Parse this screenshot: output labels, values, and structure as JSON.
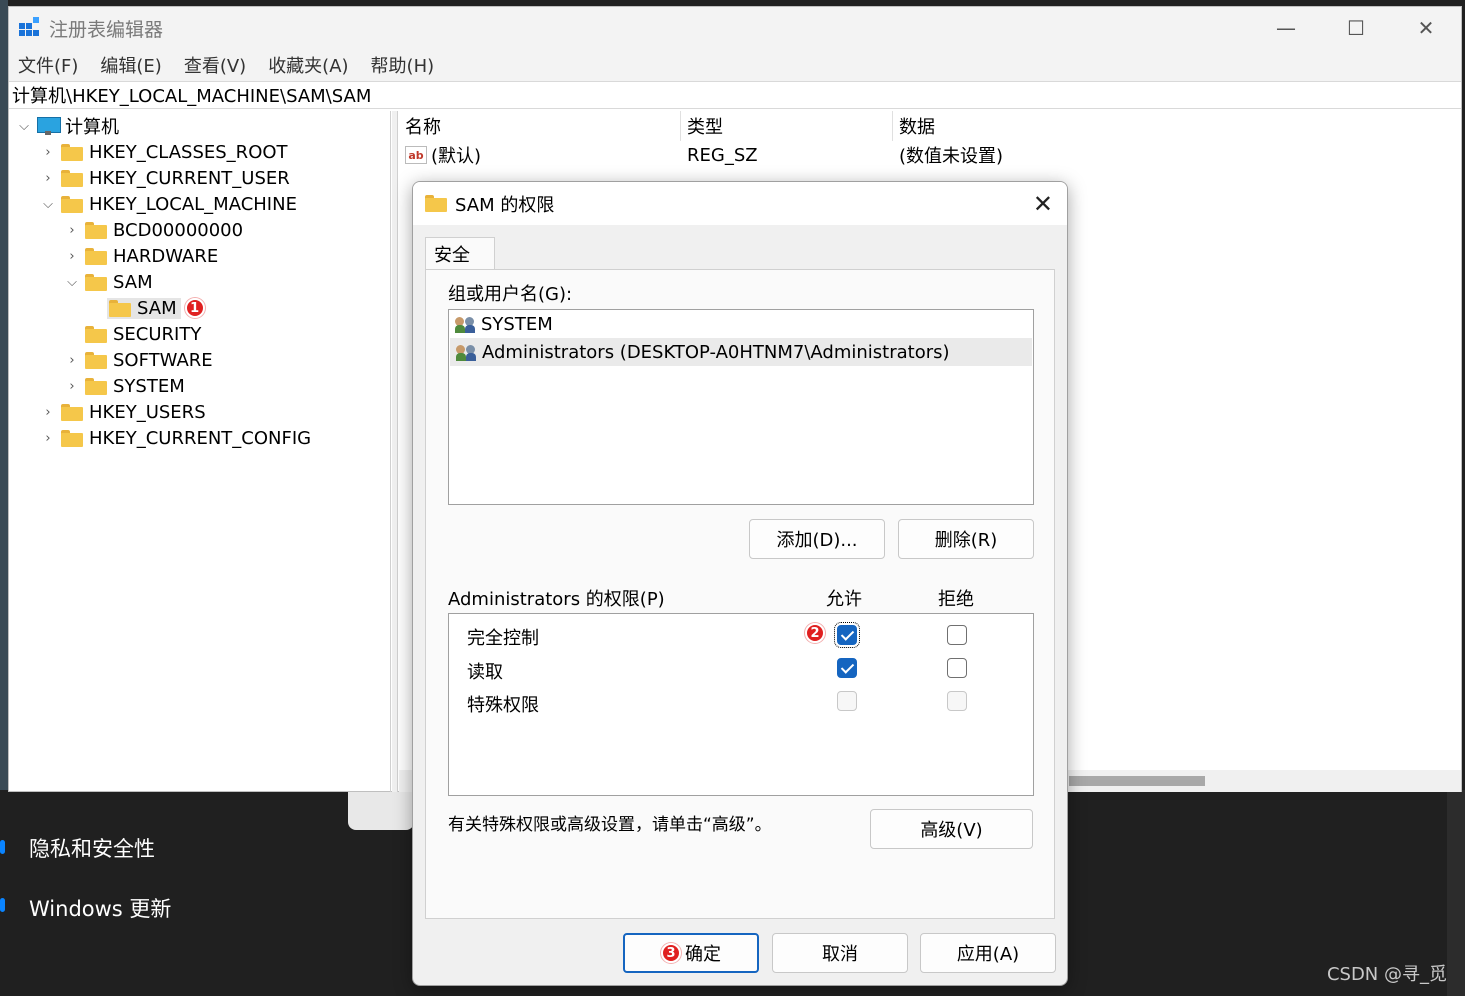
{
  "desktop": {
    "items": [
      "隐私和安全性",
      "Windows 更新"
    ],
    "watermark": "CSDN @寻_觅"
  },
  "regedit": {
    "title": "注册表编辑器",
    "menu": [
      "文件(F)",
      "编辑(E)",
      "查看(V)",
      "收藏夹(A)",
      "帮助(H)"
    ],
    "address": "计算机\\HKEY_LOCAL_MACHINE\\SAM\\SAM",
    "tree": {
      "root": "计算机",
      "hkcr": "HKEY_CLASSES_ROOT",
      "hkcu": "HKEY_CURRENT_USER",
      "hklm": "HKEY_LOCAL_MACHINE",
      "bcd": "BCD00000000",
      "hardware": "HARDWARE",
      "sam": "SAM",
      "sam_sam": "SAM",
      "security": "SECURITY",
      "software": "SOFTWARE",
      "system": "SYSTEM",
      "hku": "HKEY_USERS",
      "hkcc": "HKEY_CURRENT_CONFIG",
      "badge": "1"
    },
    "list": {
      "headers": [
        "名称",
        "类型",
        "数据"
      ],
      "rows": [
        {
          "name": "(默认)",
          "type": "REG_SZ",
          "data": "(数值未设置)"
        }
      ]
    }
  },
  "dialog": {
    "title": "SAM 的权限",
    "tab": "安全",
    "group_label": "组或用户名(G):",
    "users": [
      "SYSTEM",
      "Administrators (DESKTOP-A0HTNM7\\Administrators)"
    ],
    "add_button": "添加(D)...",
    "remove_button": "删除(R)",
    "perm_label": "Administrators 的权限(P)",
    "allow_header": "允许",
    "deny_header": "拒绝",
    "permissions": [
      {
        "name": "完全控制",
        "allow": true,
        "deny": false
      },
      {
        "name": "读取",
        "allow": true,
        "deny": false
      },
      {
        "name": "特殊权限",
        "allow": false,
        "deny": false
      }
    ],
    "advanced_hint": "有关特殊权限或高级设置，请单击“高级”。",
    "advanced_button": "高级(V)",
    "ok_button": "确定",
    "cancel_button": "取消",
    "apply_button": "应用(A)",
    "badge_fullcontrol": "2",
    "badge_ok": "3"
  },
  "colors": {
    "accent": "#1565c0",
    "badge": "#e02020",
    "folder": "#f5c74a"
  }
}
